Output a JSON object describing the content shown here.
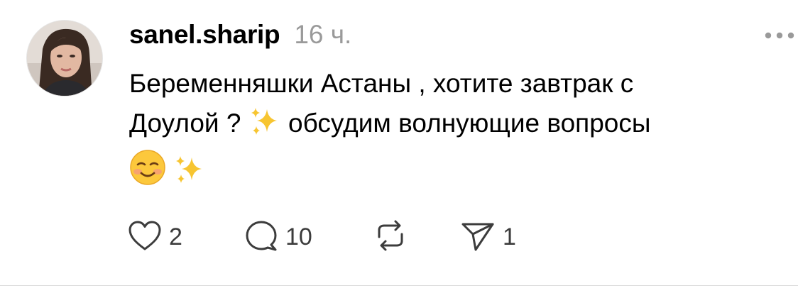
{
  "post": {
    "username": "sanel.sharip",
    "timestamp": "16 ч.",
    "text_line1": "Беременняшки Астаны , хотите завтрак с",
    "text_line2a": "Доулой ?",
    "text_line2b": "обсудим волнующие вопросы",
    "emoji": {
      "sparkles": "sparkles-emoji",
      "smiling": "smiling-face-emoji"
    }
  },
  "actions": {
    "like_count": "2",
    "reply_count": "10",
    "repost_count": "",
    "share_count": "1"
  },
  "icons": {
    "more": "more-icon",
    "like": "heart-icon",
    "reply": "comment-icon",
    "repost": "repost-icon",
    "share": "send-icon"
  },
  "colors": {
    "text": "#000000",
    "muted": "#9a9a9a",
    "icon": "#3c3c3c",
    "sparkle": "#f7c531"
  }
}
